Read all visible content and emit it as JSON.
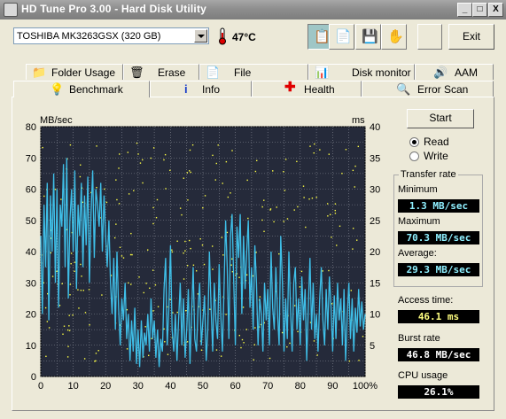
{
  "window": {
    "title": "HD Tune Pro 3.00 - Hard Disk Utility",
    "controls": [
      "_",
      "□",
      "X"
    ]
  },
  "toolbar": {
    "drive": "TOSHIBA MK3263GSX (320 GB)",
    "temperature": "47°C",
    "exit_label": "Exit",
    "icons": [
      "copy-info-icon",
      "copy-screenshot-icon",
      "save-icon",
      "options-icon"
    ]
  },
  "tabs_top": [
    {
      "label": "Folder Usage",
      "icon": "folder-icon"
    },
    {
      "label": "Erase",
      "icon": "trash-icon"
    },
    {
      "label": "File Benchmark",
      "icon": "file-benchmark-icon"
    },
    {
      "label": "Disk monitor",
      "icon": "disk-monitor-icon"
    },
    {
      "label": "AAM",
      "icon": "speaker-icon"
    }
  ],
  "tabs_bottom": [
    {
      "label": "Benchmark",
      "icon": "lightbulb-icon",
      "active": true
    },
    {
      "label": "Info",
      "icon": "info-icon"
    },
    {
      "label": "Health",
      "icon": "health-cross-icon"
    },
    {
      "label": "Error Scan",
      "icon": "magnifier-icon"
    }
  ],
  "controls": {
    "start_label": "Start",
    "read_label": "Read",
    "write_label": "Write",
    "selected": "Read"
  },
  "transfer_rate": {
    "group_title": "Transfer rate",
    "minimum_label": "Minimum",
    "minimum": "1.3 MB/sec",
    "maximum_label": "Maximum",
    "maximum": "70.3 MB/sec",
    "average_label": "Average:",
    "average": "29.3 MB/sec"
  },
  "access_time_label": "Access time:",
  "access_time": "46.1 ms",
  "burst_rate_label": "Burst rate",
  "burst_rate": "46.8 MB/sec",
  "cpu_usage_label": "CPU usage",
  "cpu_usage": "26.1%",
  "colors": {
    "plot_bg": "#252a3a",
    "grid": "#8a8f9a",
    "transfer_line": "#3fbfe8",
    "access_points": "#ffff44",
    "value_cyan": "#8ff0ff",
    "value_yellow": "#ffff80"
  },
  "chart_data": {
    "type": "line",
    "left_axis_label": "MB/sec",
    "right_axis_label": "ms",
    "y_ticks": [
      "80",
      "70",
      "60",
      "50",
      "40",
      "30",
      "20",
      "10",
      "0"
    ],
    "y2_ticks": [
      "40",
      "35",
      "30",
      "25",
      "20",
      "15",
      "10",
      "5"
    ],
    "x_ticks": [
      "0",
      "10",
      "20",
      "30",
      "40",
      "50",
      "60",
      "70",
      "80",
      "90",
      "100%"
    ],
    "ylim": [
      0,
      80
    ],
    "y2lim": [
      0,
      40
    ],
    "xlim": [
      0,
      100
    ],
    "series": [
      {
        "kind": "transfer_rate_mbps",
        "x": [
          0,
          0.5,
          1,
          1.5,
          2,
          2.5,
          3,
          3.5,
          4,
          4.5,
          5,
          5.5,
          6,
          6.5,
          7,
          7.5,
          8,
          8.5,
          9,
          9.5,
          10,
          10.5,
          11,
          11.5,
          12,
          12.5,
          13,
          13.5,
          14,
          14.5,
          15,
          15.5,
          16,
          16.5,
          17,
          17.5,
          18,
          18.5,
          19,
          19.5,
          20,
          20.5,
          21,
          21.5,
          22,
          22.5,
          23,
          23.5,
          24,
          24.5,
          25,
          25.5,
          26,
          26.5,
          27,
          27.5,
          28,
          28.5,
          29,
          29.5,
          30,
          30.5,
          31,
          31.5,
          32,
          32.5,
          33,
          33.5,
          34,
          34.5,
          35,
          35.5,
          36,
          36.5,
          37,
          37.5,
          38,
          38.5,
          39,
          39.5,
          40,
          40.5,
          41,
          41.5,
          42,
          42.5,
          43,
          43.5,
          44,
          44.5,
          45,
          45.5,
          46,
          46.5,
          47,
          47.5,
          48,
          48.5,
          49,
          49.5,
          50,
          50.5,
          51,
          51.5,
          52,
          52.5,
          53,
          53.5,
          54,
          54.5,
          55,
          55.5,
          56,
          56.5,
          57,
          57.5,
          58,
          58.5,
          59,
          59.5,
          60,
          60.5,
          61,
          61.5,
          62,
          62.5,
          63,
          63.5,
          64,
          64.5,
          65,
          65.5,
          66,
          66.5,
          67,
          67.5,
          68,
          68.5,
          69,
          69.5,
          70,
          70.5,
          71,
          71.5,
          72,
          72.5,
          73,
          73.5,
          74,
          74.5,
          75,
          75.5,
          76,
          76.5,
          77,
          77.5,
          78,
          78.5,
          79,
          79.5,
          80,
          80.5,
          81,
          81.5,
          82,
          82.5,
          83,
          83.5,
          84,
          84.5,
          85,
          85.5,
          86,
          86.5,
          87,
          87.5,
          88,
          88.5,
          89,
          89.5,
          90,
          90.5,
          91,
          91.5,
          92,
          92.5,
          93,
          93.5,
          94,
          94.5,
          95,
          95.5,
          96,
          96.5,
          97,
          97.5,
          98,
          98.5,
          99,
          99.5,
          100
        ],
        "y": [
          45,
          20,
          55,
          35,
          62,
          18,
          58,
          40,
          65,
          30,
          60,
          22,
          55,
          48,
          68,
          35,
          70,
          25,
          50,
          60,
          40,
          66,
          28,
          55,
          45,
          62,
          35,
          58,
          42,
          64,
          30,
          52,
          66,
          38,
          60,
          55,
          48,
          62,
          40,
          58,
          45,
          35,
          50,
          30,
          20,
          38,
          15,
          40,
          22,
          10,
          25,
          18,
          30,
          12,
          20,
          5,
          18,
          8,
          22,
          4,
          15,
          3,
          18,
          6,
          14,
          10,
          20,
          8,
          25,
          12,
          18,
          6,
          15,
          3,
          12,
          8,
          28,
          38,
          10,
          22,
          42,
          15,
          8,
          20,
          5,
          18,
          30,
          10,
          25,
          6,
          15,
          28,
          4,
          20,
          35,
          12,
          8,
          22,
          30,
          10,
          18,
          26,
          5,
          15,
          40,
          22,
          8,
          30,
          18,
          12,
          36,
          20,
          8,
          28,
          50,
          35,
          12,
          45,
          52,
          30,
          10,
          48,
          38,
          52,
          20,
          45,
          28,
          40,
          50,
          22,
          35,
          15,
          42,
          30,
          10,
          25,
          20,
          8,
          30,
          18,
          28,
          10,
          40,
          22,
          15,
          35,
          20,
          10,
          45,
          30,
          8,
          25,
          12,
          40,
          22,
          8,
          30,
          35,
          15,
          25,
          10,
          32,
          18,
          28,
          5,
          22,
          38,
          15,
          30,
          12,
          20,
          8,
          25,
          35,
          18,
          10,
          28,
          15,
          32,
          22,
          8,
          26,
          12,
          30,
          18,
          25,
          10,
          28,
          5,
          20,
          30,
          12,
          25,
          8,
          22,
          14,
          28,
          16,
          24,
          15,
          20
        ]
      }
    ]
  }
}
